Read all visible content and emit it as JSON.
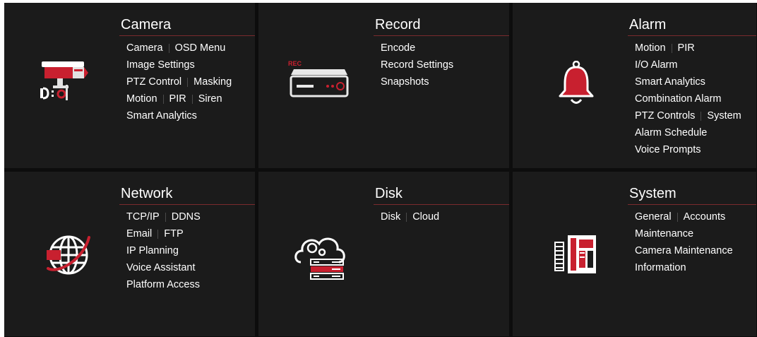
{
  "colors": {
    "accent": "#c8202f",
    "panel_bg": "#1b1b1b",
    "gutter": "#0d0d0d",
    "text": "#ffffff"
  },
  "panels": [
    {
      "title": "Camera",
      "icon": "security-camera-icon",
      "rows": [
        [
          "Camera",
          "OSD Menu"
        ],
        [
          "Image Settings"
        ],
        [
          "PTZ Control",
          "Masking"
        ],
        [
          "Motion",
          "PIR",
          "Siren"
        ],
        [
          "Smart Analytics"
        ]
      ]
    },
    {
      "title": "Record",
      "icon": "recorder-icon",
      "icon_text": "REC",
      "rows": [
        [
          "Encode"
        ],
        [
          "Record Settings"
        ],
        [
          "Snapshots"
        ]
      ]
    },
    {
      "title": "Alarm",
      "icon": "bell-icon",
      "rows": [
        [
          "Motion",
          "PIR"
        ],
        [
          "I/O Alarm"
        ],
        [
          "Smart Analytics"
        ],
        [
          "Combination Alarm"
        ],
        [
          "PTZ Controls",
          "System"
        ],
        [
          "Alarm Schedule"
        ],
        [
          "Voice Prompts"
        ]
      ]
    },
    {
      "title": "Network",
      "icon": "globe-icon",
      "rows": [
        [
          "TCP/IP",
          "DDNS"
        ],
        [
          "Email",
          "FTP"
        ],
        [
          "IP Planning"
        ],
        [
          "Voice Assistant"
        ],
        [
          "Platform Access"
        ]
      ]
    },
    {
      "title": "Disk",
      "icon": "cloud-storage-icon",
      "rows": [
        [
          "Disk",
          "Cloud"
        ]
      ]
    },
    {
      "title": "System",
      "icon": "device-panel-icon",
      "rows": [
        [
          "General",
          "Accounts"
        ],
        [
          "Maintenance"
        ],
        [
          "Camera Maintenance"
        ],
        [
          "Information"
        ]
      ]
    }
  ]
}
